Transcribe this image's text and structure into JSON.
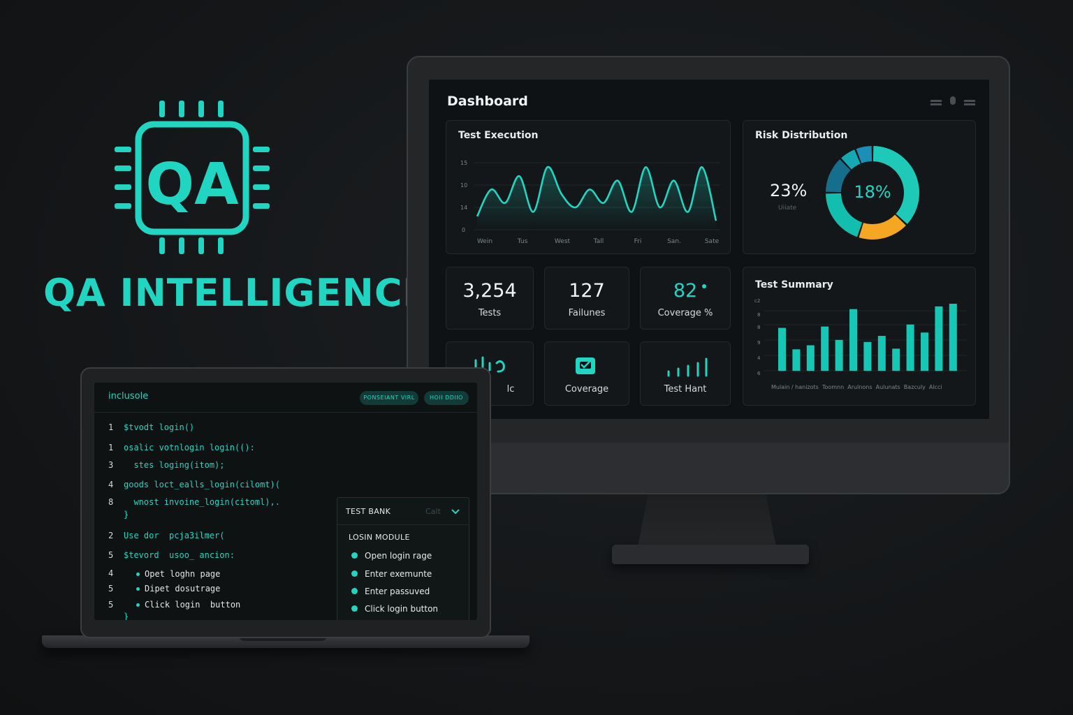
{
  "brand": {
    "name": "QA INTELLIGENCE",
    "logo_text": "QA",
    "logo_icon": "chip-icon"
  },
  "colors": {
    "accent": "#20d6c2",
    "orange": "#f5a623",
    "blue": "#1b8fb5"
  },
  "dashboard": {
    "title": "Dashboard",
    "test_execution": {
      "title": "Test Execution",
      "y_ticks": [
        "15",
        "10",
        "14",
        "0"
      ],
      "x_ticks": [
        "Wein",
        "Tus",
        "West",
        "Tall",
        "Fri",
        "San.",
        "Sate"
      ]
    },
    "risk": {
      "title": "Risk Distribution",
      "left_value": "23%",
      "left_label": "Uiiate",
      "center_value": "18%"
    },
    "stats": [
      {
        "value": "3,254",
        "label": "Tests"
      },
      {
        "value": "127",
        "label": "Failunes"
      },
      {
        "value": "82",
        "label": "Coverage %"
      }
    ],
    "tiles": [
      {
        "label": "lc",
        "icon": "bars-icon"
      },
      {
        "label": "Coverage",
        "icon": "checklist-icon"
      },
      {
        "label": "Test Hant",
        "icon": "signal-bars-icon"
      }
    ],
    "summary": {
      "title": "Test Summary",
      "y_ticks": [
        "c2",
        "8",
        "8",
        "9",
        "4",
        "6"
      ],
      "x_labels": "Mulain / hanizots  Toomnn  Arulnons  Aulunats  Bazculy  Alcci"
    }
  },
  "chart_data": [
    {
      "type": "line",
      "title": "Test Execution",
      "x": [
        "Wein",
        "Tus",
        "West",
        "Tall",
        "Fri",
        "San.",
        "Sate"
      ],
      "series": [
        {
          "values": [
            3,
            9,
            6,
            12,
            4,
            14,
            8,
            5,
            9,
            6,
            11,
            4,
            14,
            5,
            11,
            4,
            14,
            2
          ]
        }
      ]
    },
    {
      "type": "pie",
      "title": "Risk Distribution",
      "slices": [
        {
          "label": "teal",
          "value": 37
        },
        {
          "label": "orange",
          "value": 18
        },
        {
          "label": "teal-light",
          "value": 20
        },
        {
          "label": "blue-dark",
          "value": 13
        },
        {
          "label": "teal-2",
          "value": 6
        },
        {
          "label": "blue",
          "value": 6
        }
      ]
    },
    {
      "type": "bar",
      "title": "Test Summary",
      "values": [
        6.4,
        3.2,
        3.8,
        6.6,
        4.6,
        9.2,
        4.3,
        5.2,
        3.3,
        6.9,
        5.7,
        9.6,
        10
      ]
    }
  ],
  "ide": {
    "title": "inclusole",
    "btn1": "PONSEIANT VIRL",
    "btn2": "HOII DDIIO",
    "lines": [
      {
        "no": "1",
        "code": "$tvodt login()"
      },
      {
        "no": "1",
        "code": "osalic votnlogin login(():"
      },
      {
        "no": "3",
        "code": "  stes loging(itom);"
      },
      {
        "no": "4",
        "code": "goods loct_ealls_login(cilomt)("
      },
      {
        "no": "8",
        "code": "  wnost invoine_login(citoml),."
      },
      {
        "no": "",
        "code": "}"
      },
      {
        "no": "2",
        "code": "Use dor  pcja3ilmer("
      },
      {
        "no": "5",
        "code": "$tevord  usoo_ ancion:"
      },
      {
        "no": "4",
        "code": "Opet loghn page"
      },
      {
        "no": "5",
        "code": "Dipet dosutrage"
      },
      {
        "no": "5",
        "code": "Click login  button"
      },
      {
        "no": "",
        "code": "}"
      }
    ],
    "test_bank": {
      "title": "TEST BANK",
      "sub": "Calt",
      "module": "LOSIN MODULE",
      "items": [
        "Open login rage",
        "Enter exemunte",
        "Enter passuved",
        "Click login button"
      ]
    }
  }
}
